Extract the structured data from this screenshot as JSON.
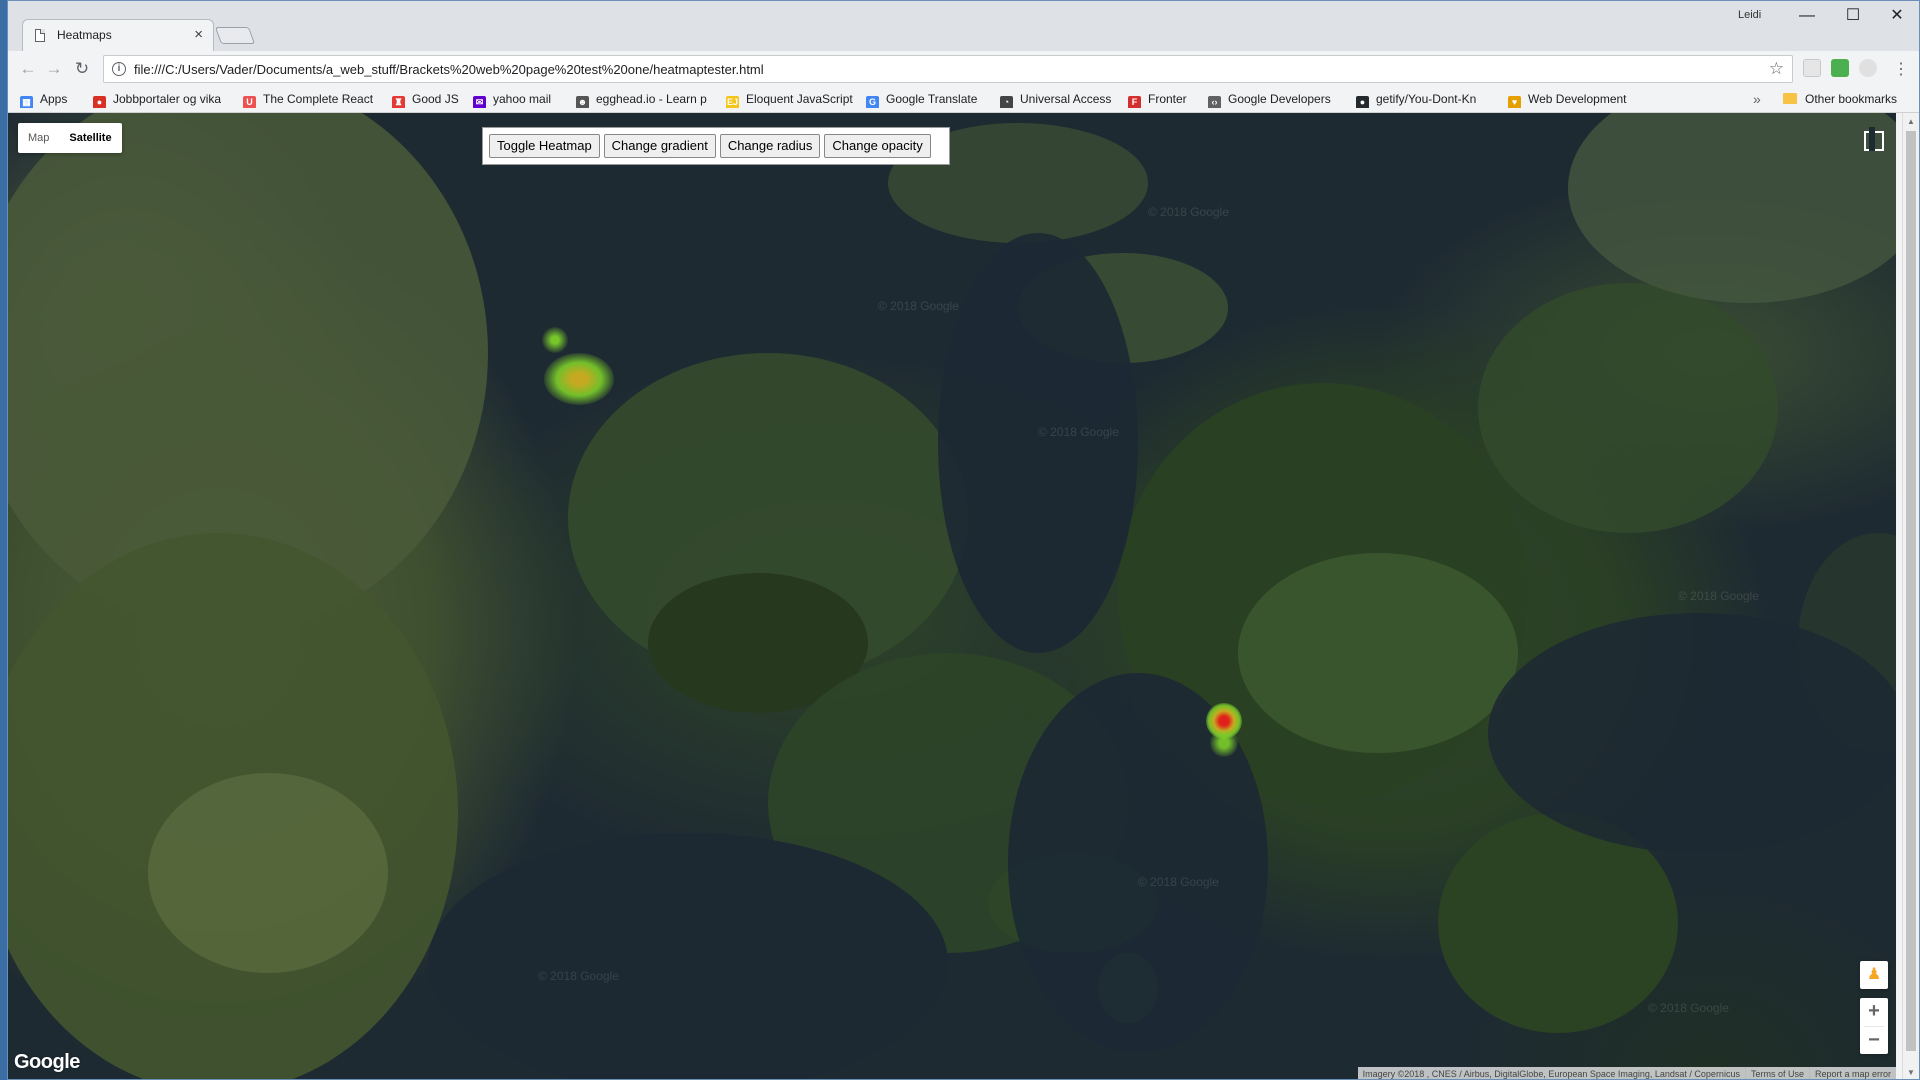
{
  "browser": {
    "tab_title": "Heatmaps",
    "tab_close": "×",
    "user_label": "Leidi",
    "window_controls": {
      "minimize": "—",
      "maximize": "☐",
      "close": "✕"
    },
    "url": "file:///C:/Users/Vader/Documents/a_web_stuff/Brackets%20web%20page%20test%20one/heatmaptester.html",
    "nav": {
      "back": "←",
      "forward": "→",
      "reload": "↻"
    },
    "star": "☆",
    "menu": "⋮",
    "bookmarks_overflow": "»",
    "bookmarks": [
      {
        "label": "Apps",
        "icon": "apps-grid-icon",
        "color": "#4285f4"
      },
      {
        "label": "Jobbportaler og vika",
        "icon": "stop-icon",
        "color": "#d93025"
      },
      {
        "label": "The Complete React",
        "icon": "udemy-icon",
        "color": "#ec5252"
      },
      {
        "label": "Good JS",
        "icon": "figure-icon",
        "color": "#e53935"
      },
      {
        "label": "yahoo mail",
        "icon": "mail-icon",
        "color": "#6001d2"
      },
      {
        "label": "egghead.io - Learn p",
        "icon": "egghead-icon",
        "color": "#555555"
      },
      {
        "label": "Eloquent JavaScript",
        "icon": "ejs-icon",
        "color": "#f5c518"
      },
      {
        "label": "Google Translate",
        "icon": "translate-icon",
        "color": "#4285f4"
      },
      {
        "label": "Universal Access",
        "icon": "access-icon",
        "color": "#444444"
      },
      {
        "label": "Fronter",
        "icon": "fronter-icon",
        "color": "#d32f2f"
      },
      {
        "label": "Google Developers",
        "icon": "code-icon",
        "color": "#616161"
      },
      {
        "label": "getify/You-Dont-Kn",
        "icon": "github-icon",
        "color": "#24292e"
      },
      {
        "label": "Web Development",
        "icon": "bookmark-icon",
        "color": "#e5a000"
      }
    ],
    "other_bookmarks": "Other bookmarks"
  },
  "map": {
    "type_controls": {
      "map": "Map",
      "satellite": "Satellite",
      "selected": "Satellite"
    },
    "panel_buttons": [
      "Toggle Heatmap",
      "Change gradient",
      "Change radius",
      "Change opacity"
    ],
    "zoom_in": "+",
    "zoom_out": "−",
    "logo": "Google",
    "watermark": "© 2018 Google",
    "attribution": {
      "imagery": "Imagery ©2018 , CNES / Airbus, DigitalGlobe, European Space Imaging, Landsat / Copernicus",
      "terms": "Terms of Use",
      "report": "Report a map error"
    },
    "colors": {
      "land_dark": "#2d4528",
      "water": "#1c2833",
      "heat_low": "#7ccf2a",
      "heat_mid": "#d0c020",
      "heat_high": "#e0201a"
    }
  }
}
